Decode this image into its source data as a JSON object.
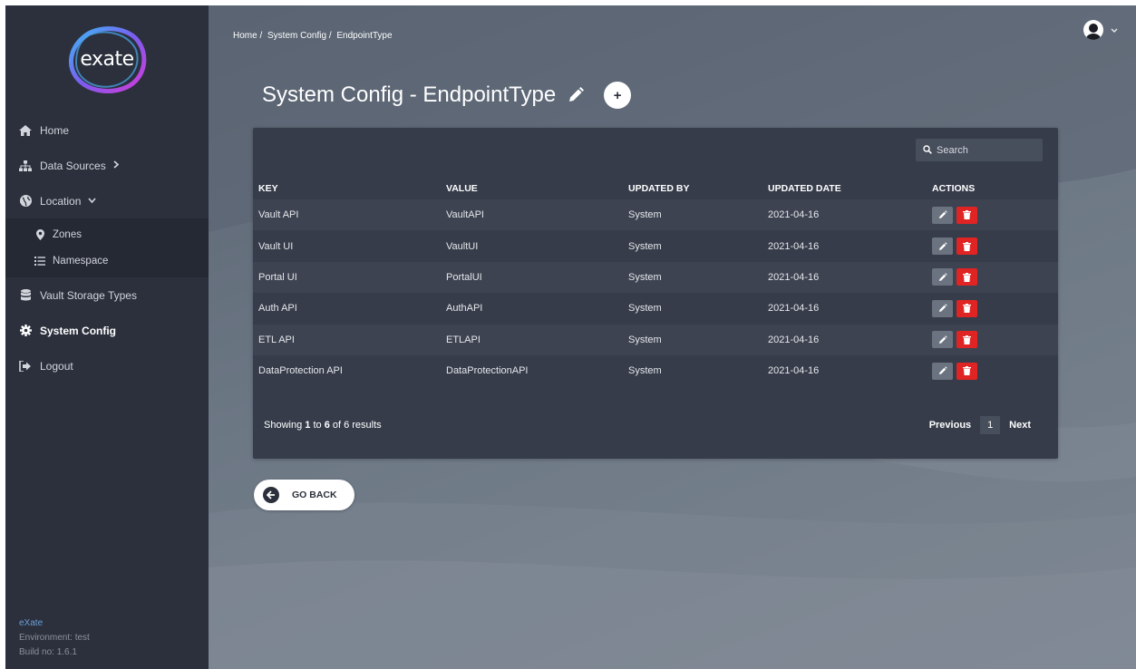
{
  "app": {
    "logo_text": "exate"
  },
  "sidebar": {
    "items": [
      {
        "label": "Home",
        "icon": "home-icon"
      },
      {
        "label": "Data Sources",
        "icon": "sitemap-icon",
        "chevron": "chevron-right-icon"
      },
      {
        "label": "Location",
        "icon": "globe-icon",
        "chevron": "chevron-down-icon"
      },
      {
        "label": "Vault Storage Types",
        "icon": "database-icon"
      },
      {
        "label": "System Config",
        "icon": "cog-icon",
        "active": true
      },
      {
        "label": "Logout",
        "icon": "logout-icon"
      }
    ],
    "location_sub": [
      {
        "label": "Zones",
        "icon": "map-pin-icon"
      },
      {
        "label": "Namespace",
        "icon": "list-icon"
      }
    ],
    "footer": {
      "brand": "eXate",
      "environment": "Environment: test",
      "build": "Build no: 1.6.1"
    }
  },
  "breadcrumb": [
    "Home /",
    "System Config /",
    "EndpointType"
  ],
  "header": {
    "title": "System Config - EndpointType",
    "add_label": "+"
  },
  "search": {
    "placeholder": "Search"
  },
  "table": {
    "columns": [
      "KEY",
      "VALUE",
      "UPDATED BY",
      "UPDATED DATE",
      "ACTIONS"
    ],
    "rows": [
      {
        "key": "Vault API",
        "value": "VaultAPI",
        "updated_by": "System",
        "updated_date": "2021-04-16"
      },
      {
        "key": "Vault UI",
        "value": "VaultUI",
        "updated_by": "System",
        "updated_date": "2021-04-16"
      },
      {
        "key": "Portal UI",
        "value": "PortalUI",
        "updated_by": "System",
        "updated_date": "2021-04-16"
      },
      {
        "key": "Auth API",
        "value": "AuthAPI",
        "updated_by": "System",
        "updated_date": "2021-04-16"
      },
      {
        "key": "ETL API",
        "value": "ETLAPI",
        "updated_by": "System",
        "updated_date": "2021-04-16"
      },
      {
        "key": "DataProtection API",
        "value": "DataProtectionAPI",
        "updated_by": "System",
        "updated_date": "2021-04-16"
      }
    ]
  },
  "pagination": {
    "showing_prefix": "Showing ",
    "from": "1",
    "to_word": " to ",
    "to": "6",
    "suffix": " of 6 results",
    "previous": "Previous",
    "current_page": "1",
    "next": "Next"
  },
  "go_back": "GO BACK",
  "colors": {
    "sidebar_bg": "#2b303c",
    "card_bg": "#363c4a",
    "delete": "#e02424",
    "edit": "#6b7280"
  }
}
